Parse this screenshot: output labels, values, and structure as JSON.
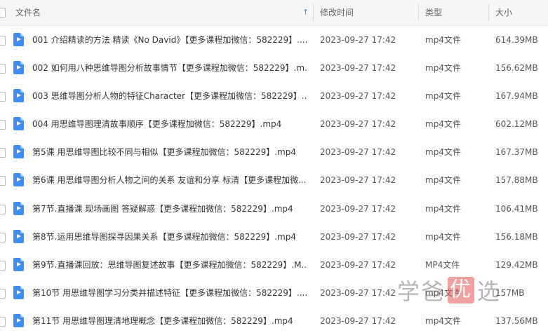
{
  "header": {
    "name": "文件名",
    "time": "修改时间",
    "type": "类型",
    "size": "大小",
    "sort_arrow": "↑"
  },
  "files": [
    {
      "name": "001 介绍精读的方法 精读《No David》【更多课程加微信：582229】....",
      "time": "2023-09-27 17:42",
      "type": "mp4文件",
      "size": "614.39MB"
    },
    {
      "name": "002 如何用八种思维导图分析故事情节【更多课程加微信：582229】.m...",
      "time": "2023-09-27 17:42",
      "type": "mp4文件",
      "size": "156.62MB"
    },
    {
      "name": "003 思维导图分析人物的特征Character【更多课程加微信：582229】....",
      "time": "2023-09-27 17:42",
      "type": "mp4文件",
      "size": "167.94MB"
    },
    {
      "name": "004 用思维导图理清故事顺序【更多课程加微信：582229】.mp4",
      "time": "2023-09-27 17:42",
      "type": "mp4文件",
      "size": "602.12MB"
    },
    {
      "name": "第5课 用思维导图比较不同与相似【更多课程加微信：582229】.mp4",
      "time": "2023-09-27 17:42",
      "type": "mp4文件",
      "size": "167.37MB"
    },
    {
      "name": "第6课 用思维导图分析人物之间的关系 友谊和分享 标清【更多课程加微...",
      "time": "2023-09-27 17:42",
      "type": "mp4文件",
      "size": "157.88MB"
    },
    {
      "name": "第7节.直播课  现场画图 答疑解惑【更多课程加微信：582229】.mp4",
      "time": "2023-09-27 17:42",
      "type": "mp4文件",
      "size": "106.41MB"
    },
    {
      "name": "第8节.运用思维导图探寻因果关系【更多课程加微信：582229】.mp4",
      "time": "2023-09-27 17:42",
      "type": "mp4文件",
      "size": "156.18MB"
    },
    {
      "name": "第9节.直播课回放：思维导图复述故事【更多课程加微信：582229】.M...",
      "time": "2023-09-27 17:42",
      "type": "MP4文件",
      "size": "129.42MB"
    },
    {
      "name": "第10节 用思维导图学习分类并描述特征【更多课程加微信：582229】....",
      "time": "2023-09-27 17:42",
      "type": "mp4文件",
      "size": "157MB"
    },
    {
      "name": "第11节 用思维导图理清地理概念【更多课程加微信：582229】.mp4",
      "time": "2023-09-27 17:42",
      "type": "mp4文件",
      "size": "137.56MB"
    }
  ],
  "watermark": {
    "left": "学爸",
    "mid": "优",
    "right": "选"
  },
  "icons": {
    "file": "video-file-icon",
    "sort": "sort-ascending-icon"
  },
  "colors": {
    "accent": "#2f86f6",
    "file_icon": "#3d8ef5"
  }
}
